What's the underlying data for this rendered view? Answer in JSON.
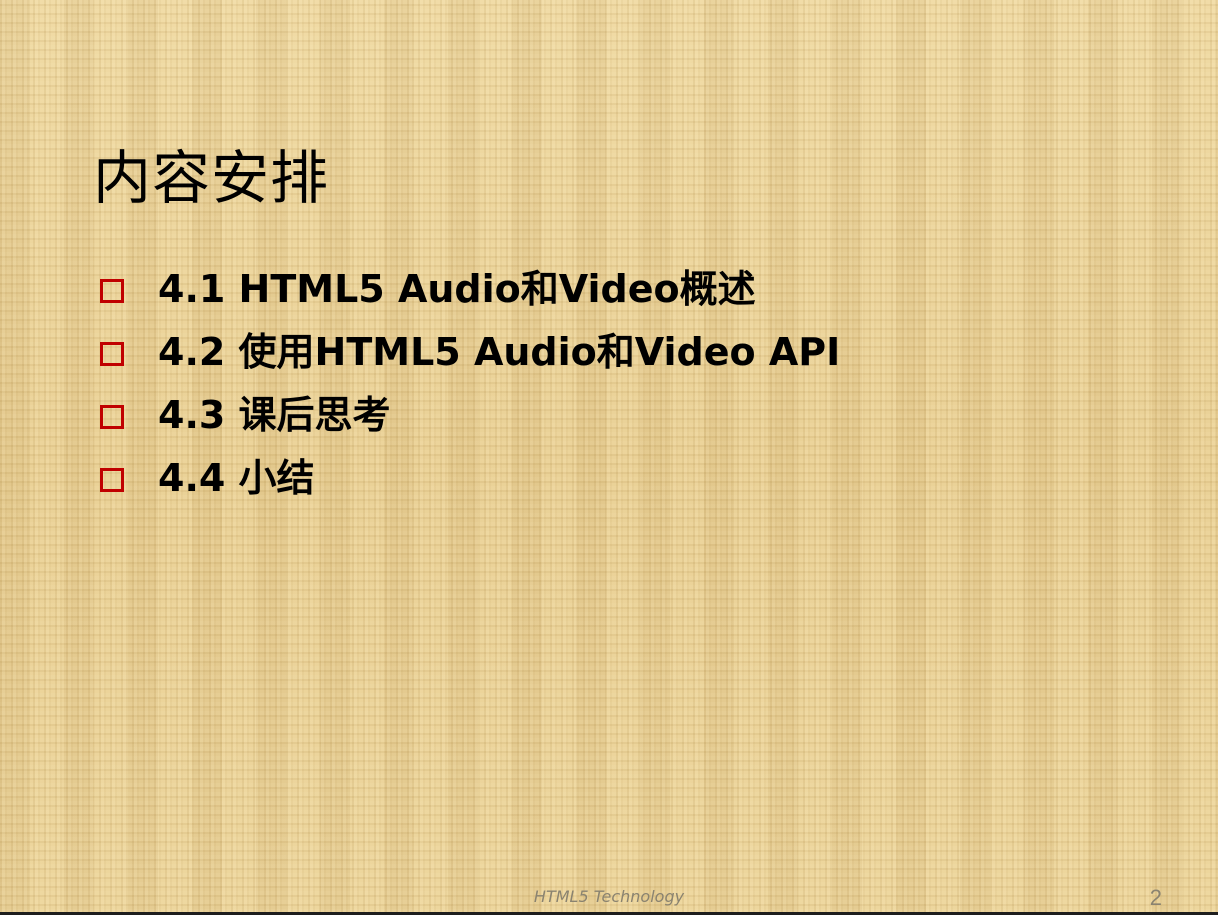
{
  "slide": {
    "title": "内容安排",
    "items": [
      {
        "label": "4.1 HTML5 Audio和Video概述"
      },
      {
        "label": "4.2 使用HTML5 Audio和Video API"
      },
      {
        "label": "4.3 课后思考"
      },
      {
        "label": "4.4 小结"
      }
    ],
    "footer": "HTML5 Technology",
    "page_number": "2"
  },
  "colors": {
    "background": "#ecd398",
    "bullet_border": "#c00000",
    "text": "#000000",
    "footer_text": "#8a8370"
  },
  "icons": {
    "bullet": "hollow-square-bullet-icon"
  }
}
